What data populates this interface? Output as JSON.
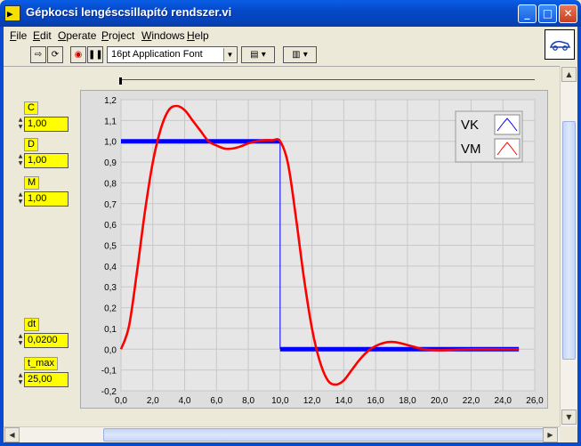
{
  "window": {
    "title": "Gépkocsi lengéscsillapító rendszer.vi",
    "minimize": "_",
    "maximize": "□",
    "close": "✕"
  },
  "menu": [
    "File",
    "Edit",
    "Operate",
    "Project",
    "Windows",
    "Help"
  ],
  "toolbar": {
    "font": "16pt Application Font"
  },
  "controls": [
    {
      "label": "C",
      "value": "1,00"
    },
    {
      "label": "D",
      "value": "1,00"
    },
    {
      "label": "M",
      "value": "1,00"
    },
    {
      "label": "dt",
      "value": "0,0200"
    },
    {
      "label": "t_max",
      "value": "25,00"
    }
  ],
  "chart_data": {
    "type": "line",
    "xlim": [
      0,
      26
    ],
    "ylim": [
      -0.2,
      1.2
    ],
    "x_ticks": [
      "0,0",
      "2,0",
      "4,0",
      "6,0",
      "8,0",
      "10,0",
      "12,0",
      "14,0",
      "16,0",
      "18,0",
      "20,0",
      "22,0",
      "24,0",
      "26,0"
    ],
    "y_ticks": [
      "1,2",
      "1,1",
      "1,0",
      "0,9",
      "0,8",
      "0,7",
      "0,6",
      "0,5",
      "0,4",
      "0,3",
      "0,2",
      "0,1",
      "0,0",
      "-0,1",
      "-0,2"
    ],
    "grid": true,
    "legend_placement": "top-right",
    "series": [
      {
        "name": "VK",
        "color": "#0000ff",
        "x": [
          0,
          10,
          10,
          25
        ],
        "y": [
          1.0,
          1.0,
          0.0,
          0.0
        ]
      },
      {
        "name": "VM",
        "color": "#ff0000",
        "x": [
          0,
          0.5,
          1,
          1.5,
          2,
          2.5,
          3,
          3.5,
          4,
          4.5,
          5,
          5.5,
          6,
          6.5,
          7,
          7.5,
          8,
          8.5,
          9,
          9.5,
          10,
          10.5,
          11,
          11.5,
          12,
          12.5,
          13,
          13.5,
          14,
          14.5,
          15,
          15.5,
          16,
          16.5,
          17,
          17.5,
          18,
          18.5,
          19,
          20,
          22,
          25
        ],
        "y": [
          0.0,
          0.11,
          0.37,
          0.66,
          0.9,
          1.06,
          1.15,
          1.17,
          1.15,
          1.1,
          1.05,
          1.0,
          0.98,
          0.965,
          0.965,
          0.975,
          0.99,
          1.0,
          1.005,
          1.005,
          1.0,
          0.89,
          0.63,
          0.34,
          0.1,
          -0.06,
          -0.15,
          -0.17,
          -0.15,
          -0.1,
          -0.05,
          -0.01,
          0.015,
          0.03,
          0.035,
          0.03,
          0.02,
          0.01,
          0.0,
          -0.005,
          0.0,
          0.0
        ]
      }
    ]
  }
}
